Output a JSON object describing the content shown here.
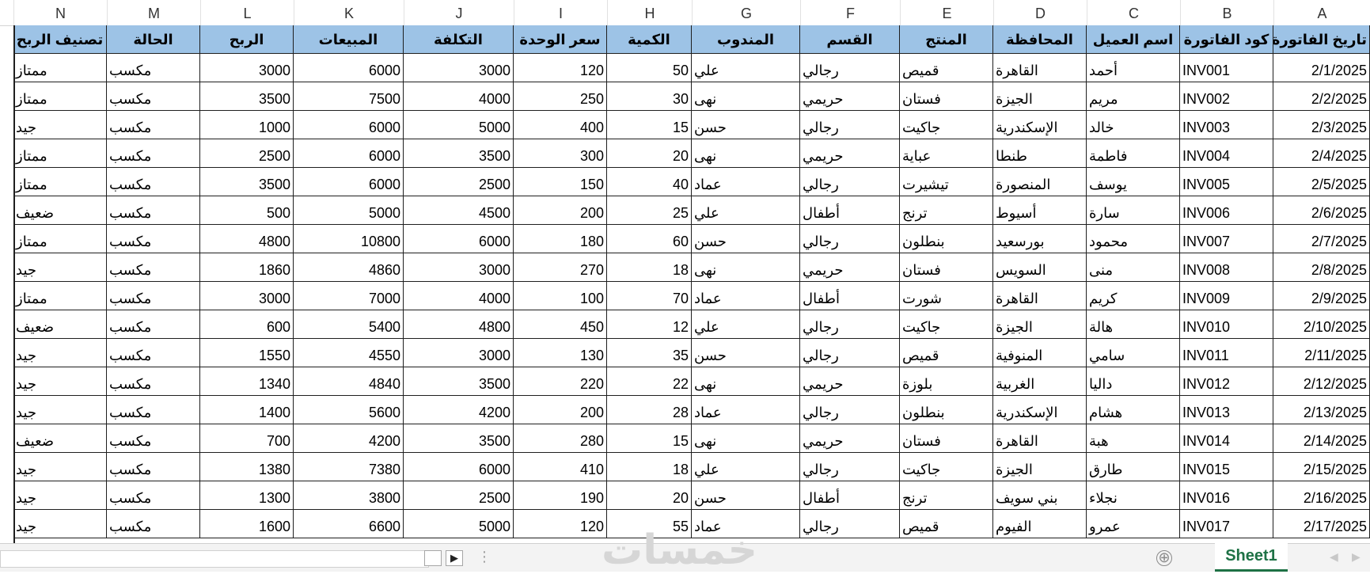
{
  "columns": [
    {
      "letter": "N",
      "header": "تصنيف الربح",
      "type": "txt"
    },
    {
      "letter": "M",
      "header": "الحالة",
      "type": "txt"
    },
    {
      "letter": "L",
      "header": "الربح",
      "type": "num"
    },
    {
      "letter": "K",
      "header": "المبيعات",
      "type": "num"
    },
    {
      "letter": "J",
      "header": "التكلفة",
      "type": "num"
    },
    {
      "letter": "I",
      "header": "سعر الوحدة",
      "type": "num"
    },
    {
      "letter": "H",
      "header": "الكمية",
      "type": "num"
    },
    {
      "letter": "G",
      "header": "المندوب",
      "type": "txt"
    },
    {
      "letter": "F",
      "header": "القسم",
      "type": "txt"
    },
    {
      "letter": "E",
      "header": "المنتج",
      "type": "txt"
    },
    {
      "letter": "D",
      "header": "المحافظة",
      "type": "txt"
    },
    {
      "letter": "C",
      "header": "اسم العميل",
      "type": "txt"
    },
    {
      "letter": "B",
      "header": "كود الفاتورة",
      "type": "code"
    },
    {
      "letter": "A",
      "header": "تاريخ الفاتورة",
      "type": "num"
    }
  ],
  "rows": [
    [
      "ممتاز",
      "مكسب",
      "3000",
      "6000",
      "3000",
      "120",
      "50",
      "علي",
      "رجالي",
      "قميص",
      "القاهرة",
      "أحمد",
      "INV001",
      "2/1/2025"
    ],
    [
      "ممتاز",
      "مكسب",
      "3500",
      "7500",
      "4000",
      "250",
      "30",
      "نهى",
      "حريمي",
      "فستان",
      "الجيزة",
      "مريم",
      "INV002",
      "2/2/2025"
    ],
    [
      "جيد",
      "مكسب",
      "1000",
      "6000",
      "5000",
      "400",
      "15",
      "حسن",
      "رجالي",
      "جاكيت",
      "الإسكندرية",
      "خالد",
      "INV003",
      "2/3/2025"
    ],
    [
      "ممتاز",
      "مكسب",
      "2500",
      "6000",
      "3500",
      "300",
      "20",
      "نهى",
      "حريمي",
      "عباية",
      "طنطا",
      "فاطمة",
      "INV004",
      "2/4/2025"
    ],
    [
      "ممتاز",
      "مكسب",
      "3500",
      "6000",
      "2500",
      "150",
      "40",
      "عماد",
      "رجالي",
      "تيشيرت",
      "المنصورة",
      "يوسف",
      "INV005",
      "2/5/2025"
    ],
    [
      "ضعيف",
      "مكسب",
      "500",
      "5000",
      "4500",
      "200",
      "25",
      "علي",
      "أطفال",
      "ترنج",
      "أسيوط",
      "سارة",
      "INV006",
      "2/6/2025"
    ],
    [
      "ممتاز",
      "مكسب",
      "4800",
      "10800",
      "6000",
      "180",
      "60",
      "حسن",
      "رجالي",
      "بنطلون",
      "بورسعيد",
      "محمود",
      "INV007",
      "2/7/2025"
    ],
    [
      "جيد",
      "مكسب",
      "1860",
      "4860",
      "3000",
      "270",
      "18",
      "نهى",
      "حريمي",
      "فستان",
      "السويس",
      "منى",
      "INV008",
      "2/8/2025"
    ],
    [
      "ممتاز",
      "مكسب",
      "3000",
      "7000",
      "4000",
      "100",
      "70",
      "عماد",
      "أطفال",
      "شورت",
      "القاهرة",
      "كريم",
      "INV009",
      "2/9/2025"
    ],
    [
      "ضعيف",
      "مكسب",
      "600",
      "5400",
      "4800",
      "450",
      "12",
      "علي",
      "رجالي",
      "جاكيت",
      "الجيزة",
      "هالة",
      "INV010",
      "2/10/2025"
    ],
    [
      "جيد",
      "مكسب",
      "1550",
      "4550",
      "3000",
      "130",
      "35",
      "حسن",
      "رجالي",
      "قميص",
      "المنوفية",
      "سامي",
      "INV011",
      "2/11/2025"
    ],
    [
      "جيد",
      "مكسب",
      "1340",
      "4840",
      "3500",
      "220",
      "22",
      "نهى",
      "حريمي",
      "بلوزة",
      "الغربية",
      "داليا",
      "INV012",
      "2/12/2025"
    ],
    [
      "جيد",
      "مكسب",
      "1400",
      "5600",
      "4200",
      "200",
      "28",
      "عماد",
      "رجالي",
      "بنطلون",
      "الإسكندرية",
      "هشام",
      "INV013",
      "2/13/2025"
    ],
    [
      "ضعيف",
      "مكسب",
      "700",
      "4200",
      "3500",
      "280",
      "15",
      "نهى",
      "حريمي",
      "فستان",
      "القاهرة",
      "هبة",
      "INV014",
      "2/14/2025"
    ],
    [
      "جيد",
      "مكسب",
      "1380",
      "7380",
      "6000",
      "410",
      "18",
      "علي",
      "رجالي",
      "جاكيت",
      "الجيزة",
      "طارق",
      "INV015",
      "2/15/2025"
    ],
    [
      "جيد",
      "مكسب",
      "1300",
      "3800",
      "2500",
      "190",
      "20",
      "حسن",
      "أطفال",
      "ترنج",
      "بني سويف",
      "نجلاء",
      "INV016",
      "2/16/2025"
    ],
    [
      "جيد",
      "مكسب",
      "1600",
      "6600",
      "5000",
      "120",
      "55",
      "عماد",
      "رجالي",
      "قميص",
      "الفيوم",
      "عمرو",
      "INV017",
      "2/17/2025"
    ]
  ],
  "bottom": {
    "sheet_tab": "Sheet1",
    "add_sheet_glyph": "⊕",
    "nav_next_glyph": "▶",
    "watermark": "خمسات"
  },
  "colors": {
    "header_fill": "#9dc3e6",
    "sheet_tab_accent": "#1e7145"
  }
}
